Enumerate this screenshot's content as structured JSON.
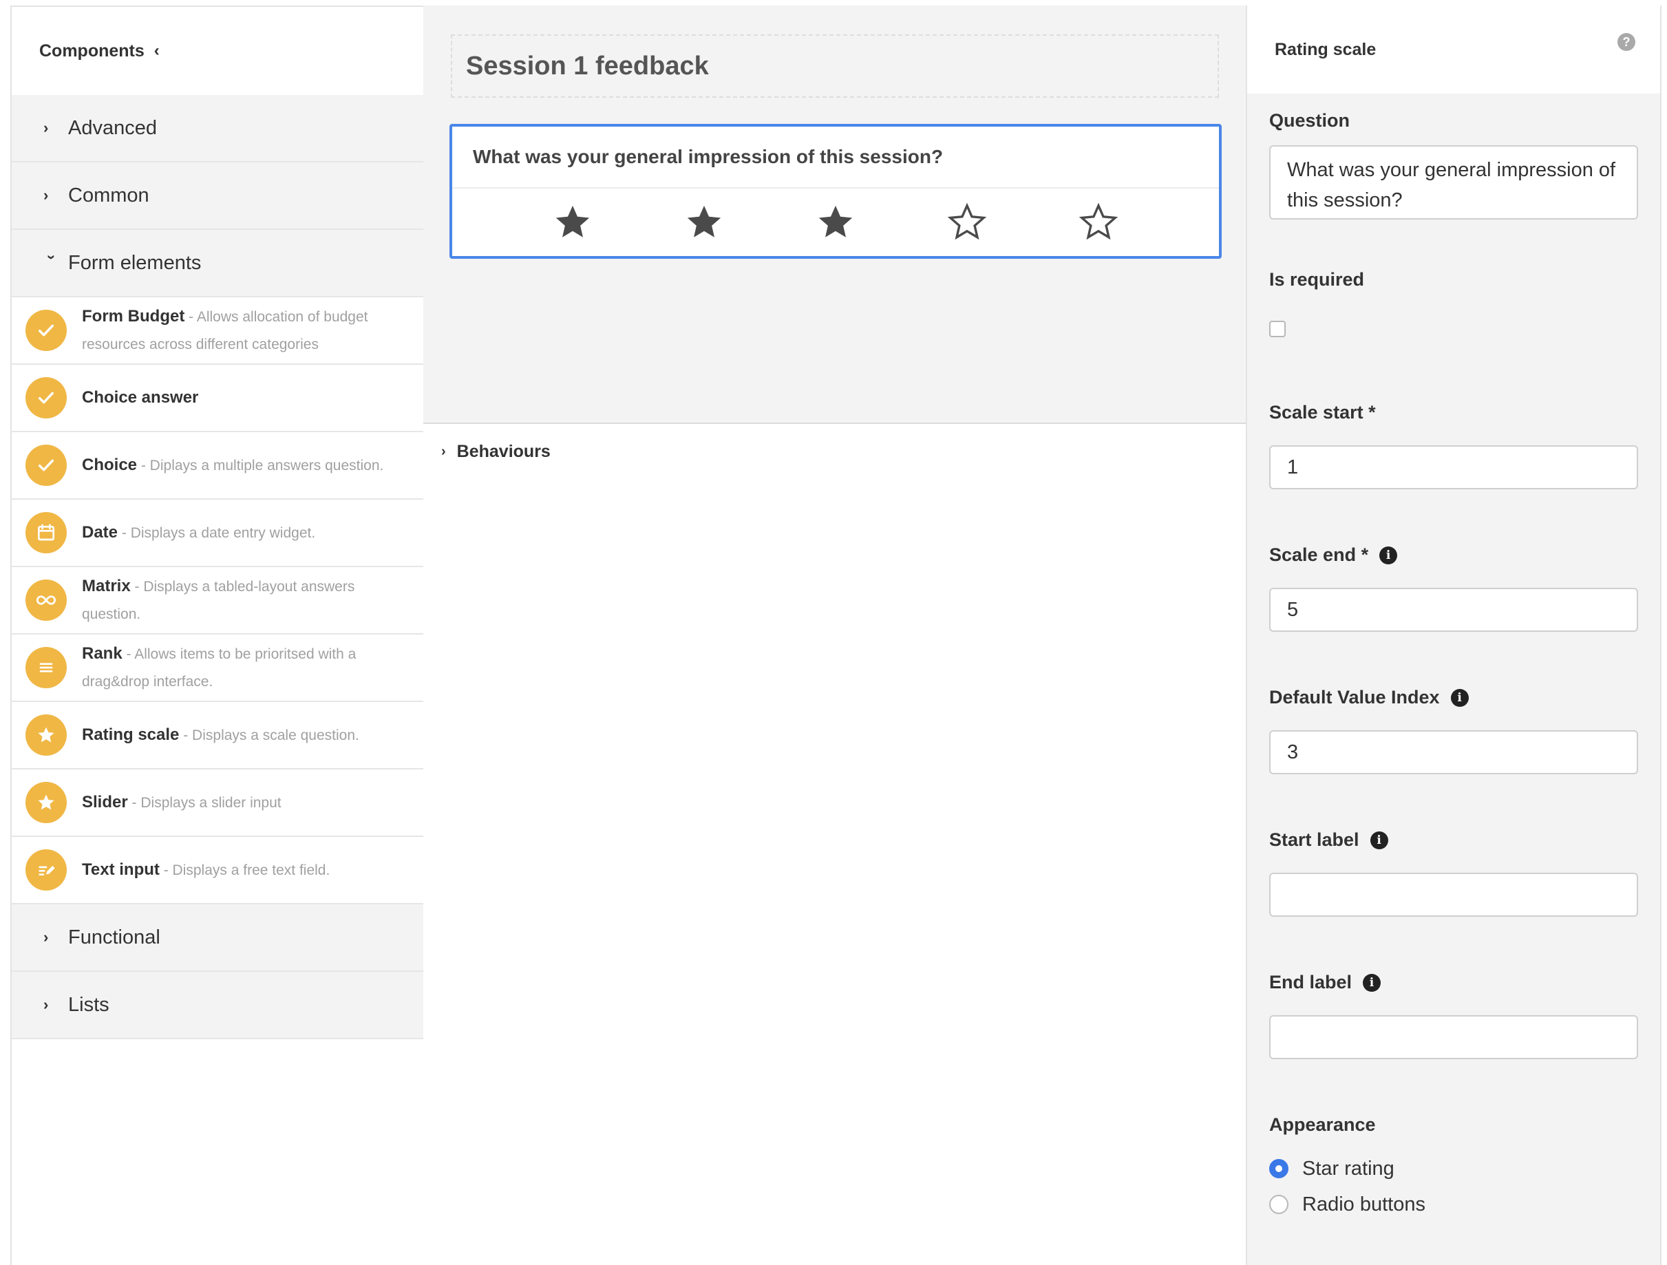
{
  "left_panel": {
    "header": "Components",
    "header_chevron": "‹",
    "groups_top": [
      {
        "label": "Advanced",
        "state": "collapsed"
      },
      {
        "label": "Common",
        "state": "collapsed"
      },
      {
        "label": "Form elements",
        "state": "expanded"
      }
    ],
    "components": [
      {
        "name": "Form Budget",
        "desc": " - Allows allocation of budget resources across different categories",
        "icon": "check-icon"
      },
      {
        "name": "Choice answer",
        "desc": "",
        "icon": "check-icon"
      },
      {
        "name": "Choice",
        "desc": " - Diplays a multiple answers question.",
        "icon": "check-icon"
      },
      {
        "name": "Date",
        "desc": " - Displays a date entry widget.",
        "icon": "calendar-icon"
      },
      {
        "name": "Matrix",
        "desc": " - Displays a tabled-layout answers question.",
        "icon": "infinity-icon"
      },
      {
        "name": "Rank",
        "desc": " - Allows items to be prioritsed with a drag&drop interface.",
        "icon": "list-icon"
      },
      {
        "name": "Rating scale",
        "desc": " - Displays a scale question.",
        "icon": "star-icon"
      },
      {
        "name": "Slider",
        "desc": " - Displays a slider input",
        "icon": "star-icon"
      },
      {
        "name": "Text input",
        "desc": " - Displays a free text field.",
        "icon": "edit-icon"
      }
    ],
    "groups_bottom": [
      {
        "label": "Functional",
        "state": "collapsed"
      },
      {
        "label": "Lists",
        "state": "collapsed"
      }
    ]
  },
  "center": {
    "form_title": "Session 1 feedback",
    "question": "What was your general impression of this session?",
    "rating": {
      "value": 3,
      "max": 5
    },
    "behaviours_label": "Behaviours"
  },
  "right_panel": {
    "header": "Rating scale",
    "help_icon": "?",
    "question_label": "Question",
    "question_value": "What was your general impression of this session?",
    "required_label": "Is required",
    "required_checked": false,
    "scale_start_label": "Scale start *",
    "scale_start_value": "1",
    "scale_end_label": "Scale end *",
    "scale_end_value": "5",
    "default_index_label": "Default Value Index",
    "default_index_value": "3",
    "start_label_label": "Start label",
    "start_label_value": "",
    "end_label_label": "End label",
    "end_label_value": "",
    "appearance_label": "Appearance",
    "appearance_options": [
      "Star rating",
      "Radio buttons"
    ],
    "appearance_selected": "Star rating",
    "info_glyph": "i"
  },
  "colors": {
    "accent_blue": "#4a86e8",
    "component_icon": "#f0b745",
    "panel_gray": "#f3f3f3"
  }
}
